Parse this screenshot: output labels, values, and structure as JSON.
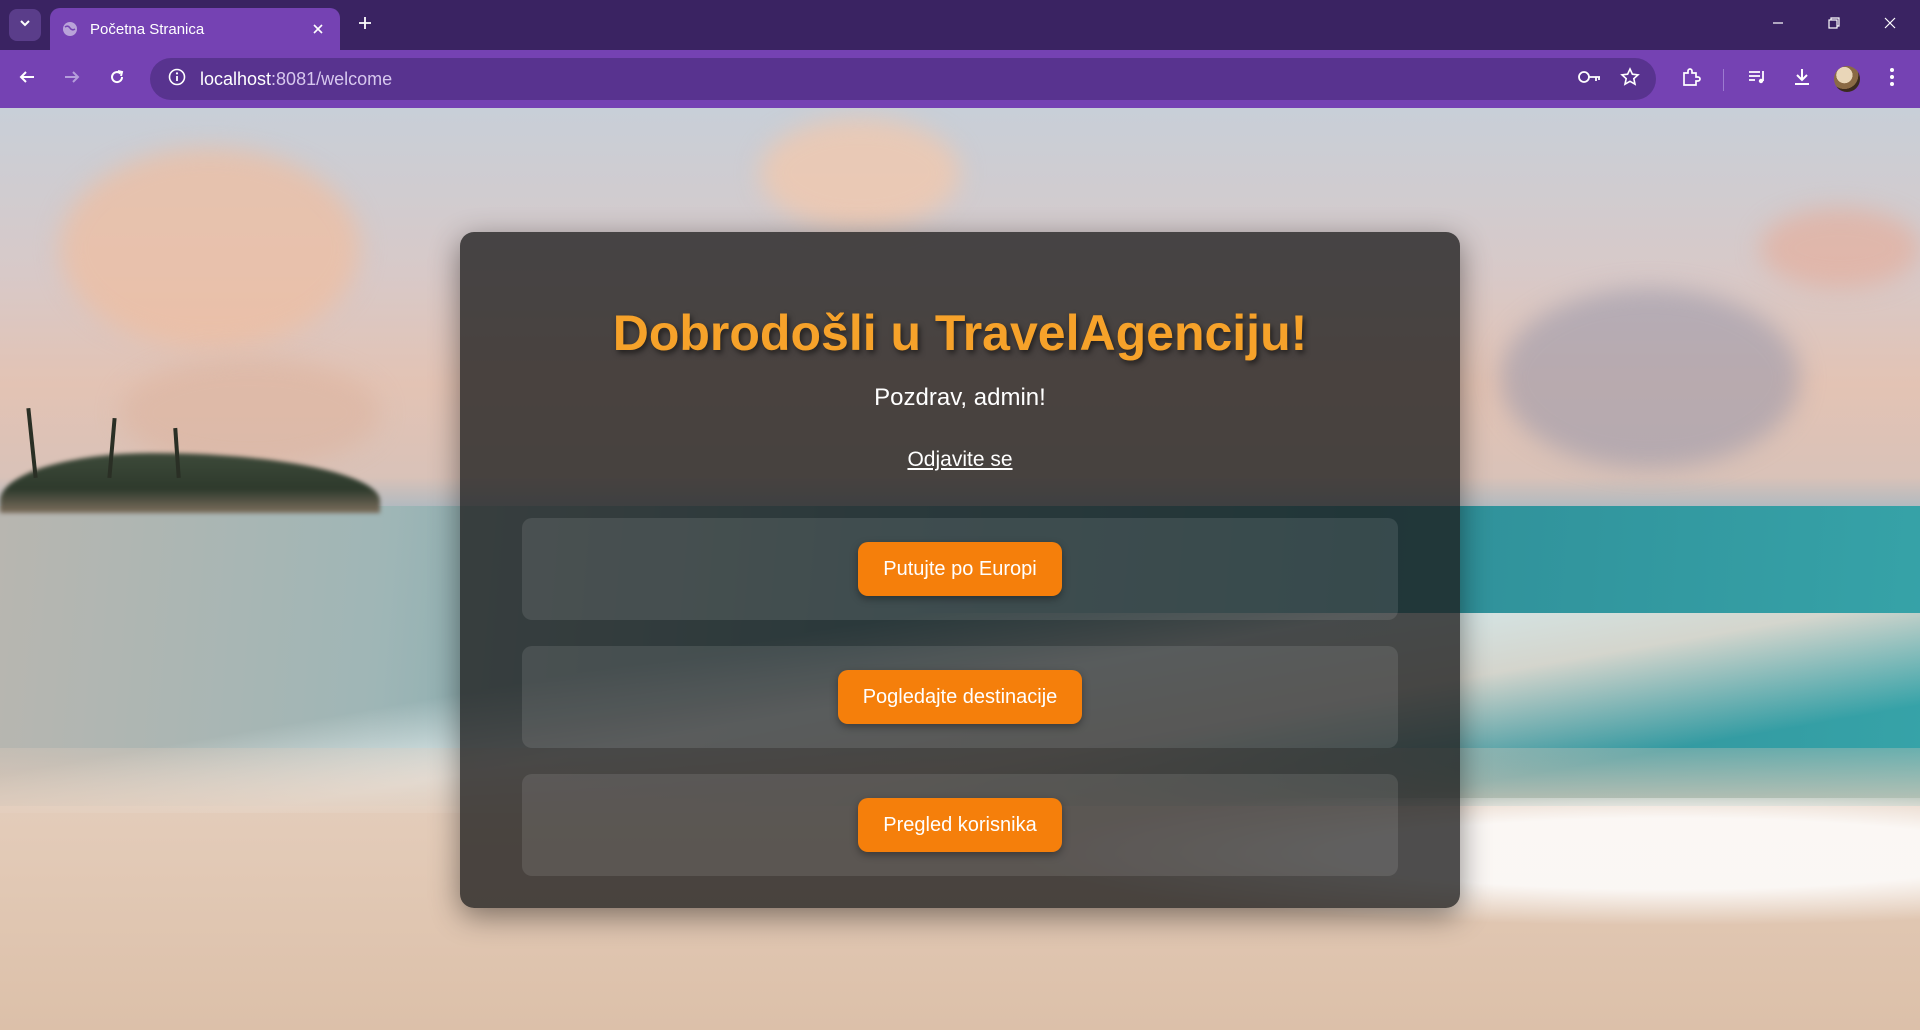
{
  "browser": {
    "tab_title": "Početna Stranica",
    "url_host": "localhost",
    "url_rest": ":8081/welcome",
    "icons": {
      "tab_search": "chevron-down-icon",
      "favicon": "globe-icon",
      "tab_close": "close-icon",
      "new_tab": "plus-icon",
      "minimize": "minimize-icon",
      "restore": "restore-icon",
      "close_window": "close-icon",
      "back": "back-arrow-icon",
      "forward": "forward-arrow-icon",
      "reload": "reload-icon",
      "site_info": "info-icon",
      "password": "key-icon",
      "bookmark": "star-icon",
      "extensions": "puzzle-icon",
      "media": "media-queue-icon",
      "downloads": "download-icon",
      "menu": "kebab-menu-icon"
    },
    "colors": {
      "tabbar": "#3a2362",
      "toolbar": "#7542b3",
      "omnibox": "#58338f"
    }
  },
  "page": {
    "title": "Dobrodošli u TravelAgenciju!",
    "greeting": "Pozdrav, admin!",
    "logout_label": "Odjavite se",
    "buttons": [
      {
        "label": "Putujte po Europi"
      },
      {
        "label": "Pogledajte destinacije"
      },
      {
        "label": "Pregled korisnika"
      }
    ],
    "colors": {
      "title": "#f6a22a",
      "button": "#f57f0b",
      "card": "rgba(30,30,30,0.78)"
    }
  }
}
